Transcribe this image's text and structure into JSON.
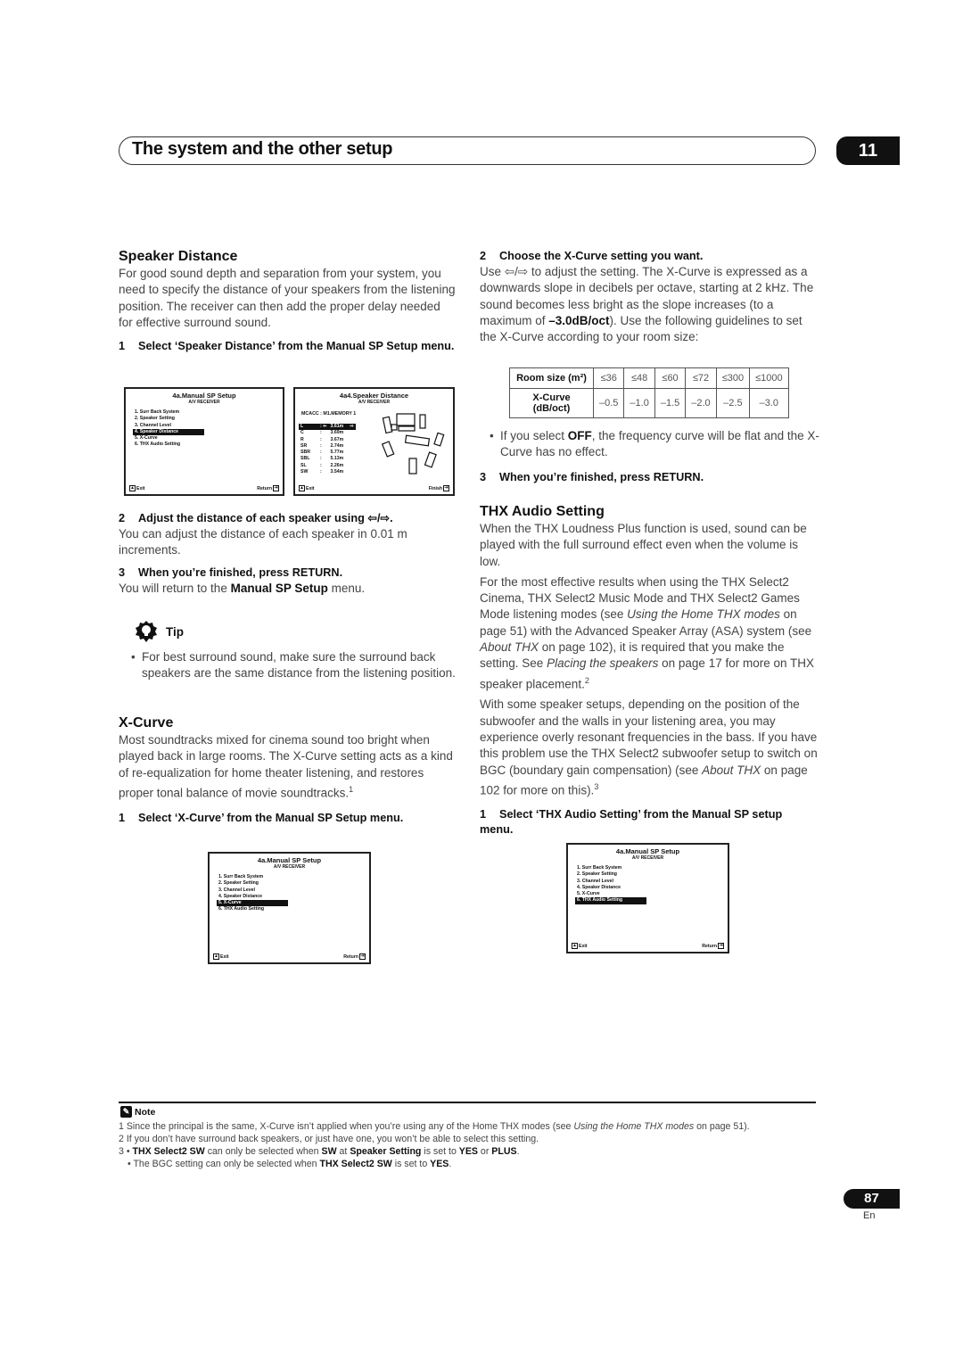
{
  "header": {
    "title": "The system and the other setup",
    "chapter": "11"
  },
  "speaker_distance": {
    "heading": "Speaker Distance",
    "intro": "For good sound depth and separation from your system, you need to specify the distance of your speakers from the listening position. The receiver can then add the proper delay needed for effective surround sound.",
    "step1": {
      "num": "1",
      "text": "Select ‘Speaker Distance’ from the Manual SP Setup menu."
    },
    "step2": {
      "num": "2",
      "text": "Adjust the distance of each speaker using ⇦/⇨.",
      "body": "You can adjust the distance of each speaker in 0.01 m increments."
    },
    "step3": {
      "num": "3",
      "text": "When you’re finished, press RETURN.",
      "body_pre": "You will return to the ",
      "body_bold": "Manual SP Setup",
      "body_post": " menu."
    },
    "tip_label": "Tip",
    "tip_text": "For best surround sound, make sure the surround back speakers are the same distance from the listening position."
  },
  "osd_menu": {
    "title": "4a.Manual SP Setup",
    "subtitle": "A/V RECEIVER",
    "items": [
      "1. Surr Back System",
      "2. Speaker Setting",
      "3. Channel Level",
      "4. Speaker Distance",
      "5. X-Curve",
      "6. THX Audio Setting"
    ],
    "exit": "Exit",
    "return": "Return"
  },
  "osd_distance": {
    "title": "4a4.Speaker Distance",
    "subtitle": "A/V RECEIVER",
    "mcacc": "MCACC : M1.MEMORY 1",
    "rows": [
      {
        "ch": "L",
        "val": "3.61m"
      },
      {
        "ch": "C",
        "val": "3.69m"
      },
      {
        "ch": "R",
        "val": "3.67m"
      },
      {
        "ch": "SR",
        "val": "2.74m"
      },
      {
        "ch": "SBR",
        "val": "5.77m"
      },
      {
        "ch": "SBL",
        "val": "5.13m"
      },
      {
        "ch": "SL",
        "val": "2.26m"
      },
      {
        "ch": "SW",
        "val": "3.54m"
      }
    ],
    "exit": "Exit",
    "finish": "Finish"
  },
  "xcurve": {
    "heading": "X-Curve",
    "intro": "Most soundtracks mixed for cinema sound too bright when played back in large rooms. The X-Curve setting acts as a kind of re-equalization for home theater listening, and restores proper tonal balance of movie soundtracks.",
    "intro_sup": "1",
    "step1": {
      "num": "1",
      "text": "Select ‘X-Curve’ from the Manual SP Setup menu."
    },
    "step2": {
      "num": "2",
      "text": "Choose the X-Curve setting you want.",
      "body_pre": "Use ⇦/⇨ to adjust the setting. The X-Curve is expressed as a downwards slope in decibels per octave, starting at 2 kHz. The sound becomes less bright as the slope increases (to a maximum of ",
      "body_bold": "–3.0dB/oct",
      "body_post": "). Use the following guidelines to set the X-Curve according to your room size:"
    },
    "table": {
      "row1_header": "Room size (m²)",
      "row2_header": "X-Curve (dB/oct)",
      "room_sizes": [
        "≤36",
        "≤48",
        "≤60",
        "≤72",
        "≤300",
        "≤1000"
      ],
      "values": [
        "–0.5",
        "–1.0",
        "–1.5",
        "–2.0",
        "–2.5",
        "–3.0"
      ]
    },
    "off_note_pre": "If you select ",
    "off_note_bold": "OFF",
    "off_note_post": ", the frequency curve will be flat and the X-Curve has no effect.",
    "step3": {
      "num": "3",
      "text": "When you’re finished, press RETURN."
    }
  },
  "thx": {
    "heading": "THX Audio Setting",
    "p1": "When the THX Loudness Plus function is used, sound can be played with the full surround effect even when the volume is low.",
    "p2_a": "For the most effective results when using the THX Select2 Cinema, THX Select2 Music Mode and THX Select2 Games Mode listening modes (see ",
    "p2_i1": "Using the Home THX modes",
    "p2_b": " on page 51) with the Advanced Speaker Array (ASA) system (see ",
    "p2_i2": "About THX",
    "p2_c": " on page 102), it is required that you make the setting. See ",
    "p2_i3": "Placing the speakers",
    "p2_d": " on page 17 for more on THX speaker placement.",
    "p2_sup": "2",
    "p3_a": "With some speaker setups, depending on the position of the subwoofer and the walls in your listening area, you may experience overly resonant frequencies in the bass. If you have this problem use the THX Select2 subwoofer setup to switch on BGC (boundary gain compensation) (see ",
    "p3_i": "About THX",
    "p3_b": " on page 102 for more on this).",
    "p3_sup": "3",
    "step1": {
      "num": "1",
      "text": "Select ‘THX Audio Setting’ from the Manual SP setup menu."
    }
  },
  "notes": {
    "label": "Note",
    "n1_a": "1 Since the principal is the same, X-Curve isn’t applied when you’re using any of the Home THX modes (see ",
    "n1_i": "Using the Home THX modes",
    "n1_b": " on page 51).",
    "n2": "2 If you don’t have surround back speakers, or just have one, you won’t be able to select this setting.",
    "n3_a": "3 • ",
    "n3_b1": "THX Select2 SW",
    "n3_c": " can only be selected when ",
    "n3_b2": "SW",
    "n3_d": " at ",
    "n3_b3": "Speaker Setting",
    "n3_e": " is set to ",
    "n3_b4": "YES",
    "n3_f": " or ",
    "n3_b5": "PLUS",
    "n3_g": ".",
    "n4_a": "• The BGC setting can only be selected when ",
    "n4_b1": "THX Select2 SW",
    "n4_c": " is set to ",
    "n4_b2": "YES",
    "n4_d": "."
  },
  "footer": {
    "page": "87",
    "lang": "En"
  }
}
